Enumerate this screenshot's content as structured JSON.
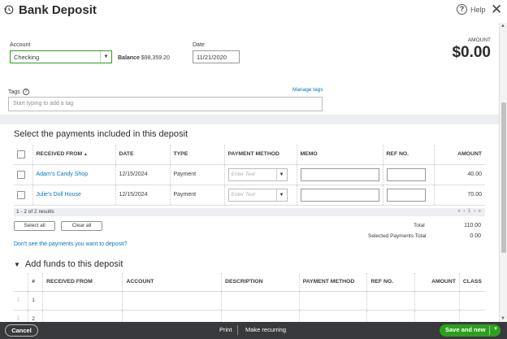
{
  "header": {
    "title": "Bank Deposit",
    "help_label": "Help",
    "close_glyph": "✕",
    "help_glyph": "?"
  },
  "account": {
    "label": "Account",
    "value": "Checking",
    "balance_label": "Balance",
    "balance_value": "$98,359.20"
  },
  "date": {
    "label": "Date",
    "value": "11/21/2020"
  },
  "amount": {
    "label": "AMOUNT",
    "value": "$0.00"
  },
  "tags": {
    "label": "Tags",
    "manage_link": "Manage tags",
    "placeholder": "Start typing to add a tag"
  },
  "payments_section": {
    "title": "Select the payments included in this deposit",
    "columns": [
      "RECEIVED FROM",
      "DATE",
      "TYPE",
      "PAYMENT METHOD",
      "MEMO",
      "REF NO.",
      "AMOUNT"
    ],
    "sort_indicator": "▲",
    "rows": [
      {
        "received_from": "Adam's Candy Shop",
        "date": "12/15/2024",
        "type": "Payment",
        "payment_method_placeholder": "Enter Text",
        "amount": "40.00"
      },
      {
        "received_from": "Julie's Doll House",
        "date": "12/15/2024",
        "type": "Payment",
        "payment_method_placeholder": "Enter Text",
        "amount": "70.00"
      }
    ],
    "results_text": "1 - 2 of 2 results",
    "pager_nav": "«  ‹  1  ›  »",
    "select_all": "Select all",
    "clear_all": "Clear all",
    "total_label": "Total",
    "total_value": "110.00",
    "selected_total_label": "Selected Payments Total",
    "selected_total_value": "0.00",
    "dont_see_link": "Don't see the payments you want to deposit?"
  },
  "add_funds_section": {
    "title": "Add funds to this deposit",
    "columns": [
      "#",
      "RECEIVED FROM",
      "ACCOUNT",
      "DESCRIPTION",
      "PAYMENT METHOD",
      "REF NO.",
      "AMOUNT",
      "CLASS"
    ],
    "row_numbers": [
      "1",
      "2"
    ]
  },
  "footer": {
    "cancel": "Cancel",
    "print": "Print",
    "make_recurring": "Make recurring",
    "save": "Save and new"
  },
  "colors": {
    "accent_green": "#2ca01c",
    "link_blue": "#0077c5",
    "footer_bg": "#393a3d"
  }
}
